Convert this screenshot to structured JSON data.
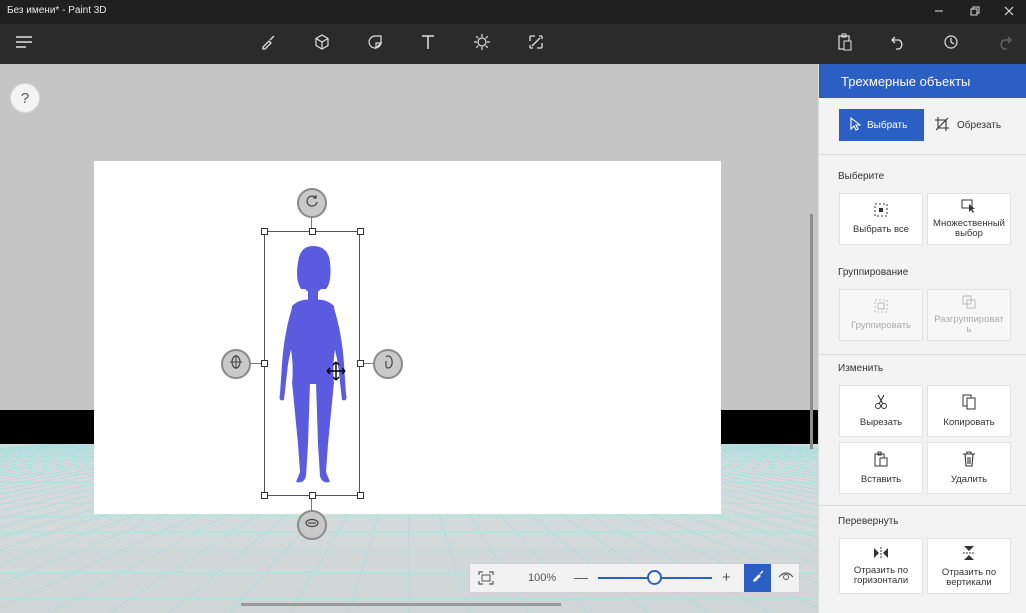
{
  "window": {
    "title": "Без имени* - Paint 3D",
    "minimize_icon": "minimize-icon",
    "restore_icon": "restore-icon",
    "close_icon": "close-icon"
  },
  "toolbar": {
    "left": [
      "menu-icon"
    ],
    "center": [
      "brushes-icon",
      "3d-shapes-icon",
      "stickers-icon",
      "text-icon",
      "effects-icon",
      "canvas-icon"
    ],
    "right": [
      "paste-icon",
      "undo-icon",
      "history-icon",
      "redo-icon"
    ]
  },
  "canvas": {
    "help_label": "?"
  },
  "zoom": {
    "percent": "100%",
    "minus": "—",
    "plus": "+",
    "slider_value_fraction": 0.5
  },
  "panel": {
    "title": "Трехмерные объекты",
    "modes": {
      "select": "Выбрать",
      "crop": "Обрезать"
    },
    "sections": {
      "select": {
        "label": "Выберите",
        "select_all": "Выбрать все",
        "multi_select_line1": "Множественный",
        "multi_select_line2": "выбор"
      },
      "grouping": {
        "label": "Группирование",
        "group": "Группировать",
        "ungroup_line1": "Разгруппироват",
        "ungroup_line2": "ь"
      },
      "edit": {
        "label": "Изменить",
        "cut": "Вырезать",
        "copy": "Копировать",
        "paste": "Вставить",
        "delete": "Удалить"
      },
      "flip": {
        "label": "Перевернуть",
        "flip_h_line1": "Отразить по",
        "flip_h_line2": "горизонтали",
        "flip_v_line1": "Отразить по",
        "flip_v_line2": "вертикали"
      }
    }
  },
  "colors": {
    "accent": "#2b5fc4",
    "figure": "#5b5be0",
    "titlebar": "#202020",
    "toolbar": "#2b2b2b"
  }
}
